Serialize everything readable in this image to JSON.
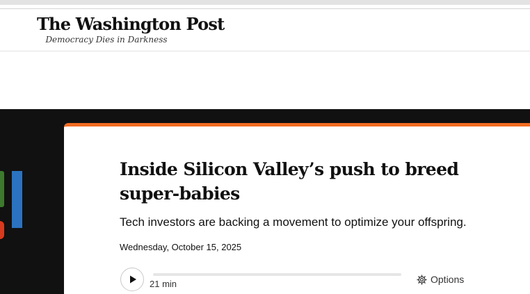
{
  "header": {
    "logo_text": "The Washington Post",
    "tagline": "Democracy Dies in Darkness"
  },
  "article": {
    "headline": "Inside Silicon Valley’s push to breed super-babies",
    "subheadline": "Tech investors are backing a movement to optimize your offspring.",
    "date": "Wednesday, October 15, 2025"
  },
  "audio_player": {
    "play_icon": "play-icon",
    "progress": 0,
    "duration": "21 min",
    "options_label": "Options",
    "options_icon": "gear-icon"
  },
  "colors": {
    "accent": "#f26b21",
    "hero_background": "#111111",
    "text": "#111111"
  }
}
